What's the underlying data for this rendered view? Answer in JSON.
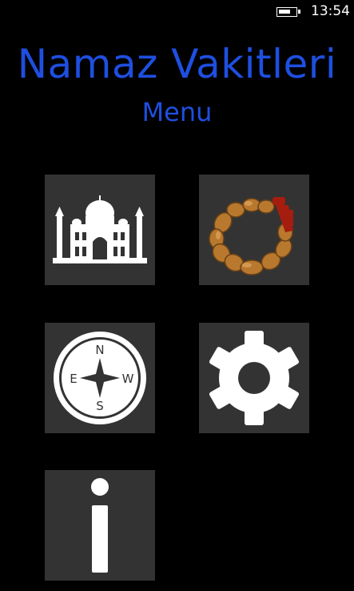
{
  "status": {
    "time": "13:54",
    "battery_level": 0.75
  },
  "header": {
    "title": "Namaz Vakitleri",
    "subtitle": "Menu"
  },
  "tiles": [
    {
      "icon": "mosque-icon"
    },
    {
      "icon": "prayer-beads-icon"
    },
    {
      "icon": "compass-icon",
      "compass": {
        "n": "N",
        "e": "E",
        "s": "S",
        "w": "W"
      }
    },
    {
      "icon": "gear-icon"
    },
    {
      "icon": "info-icon"
    }
  ],
  "colors": {
    "accent": "#1e4fe0",
    "tile": "#333333",
    "background": "#000000"
  }
}
